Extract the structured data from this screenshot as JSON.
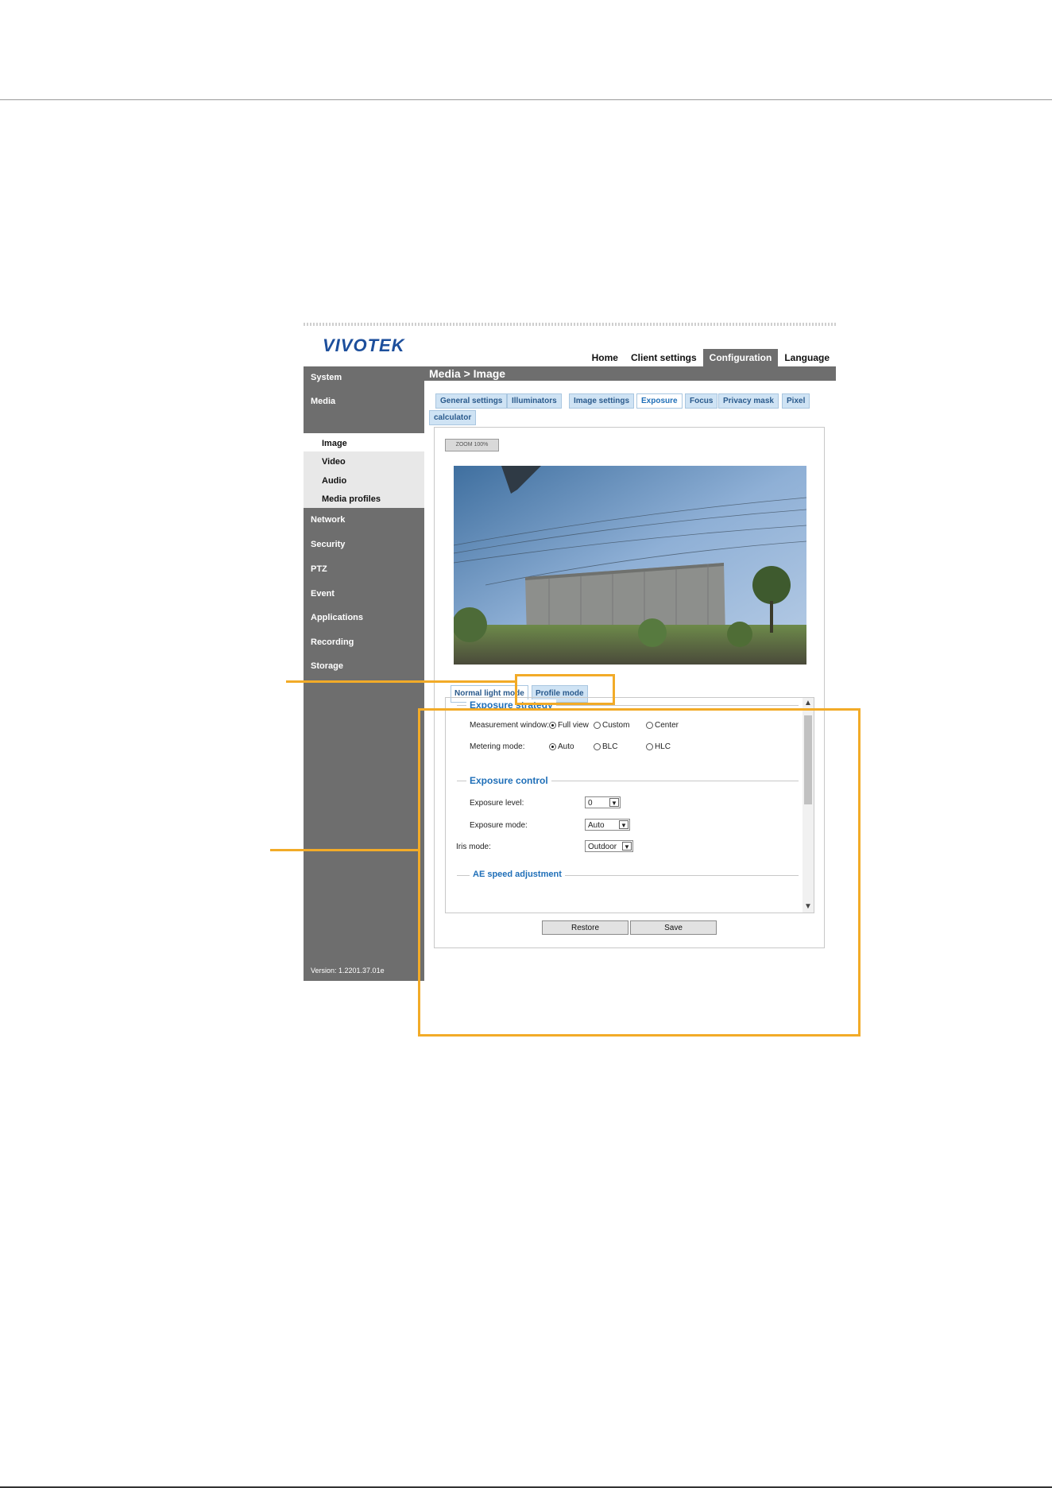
{
  "app": {
    "logo": "VIVOTEK",
    "top_nav": [
      "Home",
      "Client settings",
      "Configuration",
      "Language"
    ],
    "top_nav_active": "Configuration",
    "breadcrumb": "Media  > Image"
  },
  "sidebar": {
    "items": [
      "System",
      "Media",
      "Network",
      "Security",
      "PTZ",
      "Event",
      "Applications",
      "Recording",
      "Storage"
    ],
    "media_sub": [
      "Image",
      "Video",
      "Audio",
      "Media profiles"
    ],
    "version": "Version: 1.2201.37.01e"
  },
  "tabs": [
    "General settings",
    "Illuminators",
    "Image settings",
    "Exposure",
    "Focus",
    "Privacy mask",
    "Pixel",
    "calculator"
  ],
  "active_tab": "Exposure",
  "preview": {
    "zoom_control": "ZOOM 100%"
  },
  "subtabs": [
    "Normal light mode",
    "Profile mode"
  ],
  "exposure": {
    "strategy_title": "Exposure strategy",
    "measurement_label": "Measurement window:",
    "measurement_options": [
      "Full view",
      "Custom",
      "Center"
    ],
    "metering_label": "Metering mode:",
    "metering_options": [
      "Auto",
      "BLC",
      "HLC"
    ],
    "control_title": "Exposure control",
    "level_label": "Exposure level:",
    "level_value": "0",
    "mode_label": "Exposure mode:",
    "mode_value": "Auto",
    "iris_label": "Iris mode:",
    "iris_value": "Outdoor",
    "ae_title": "AE speed adjustment"
  },
  "buttons": {
    "restore": "Restore",
    "save": "Save"
  },
  "colors": {
    "sidebar": "#6e6e6e",
    "accent": "#1f6fb8",
    "callout": "#f2ab28"
  }
}
